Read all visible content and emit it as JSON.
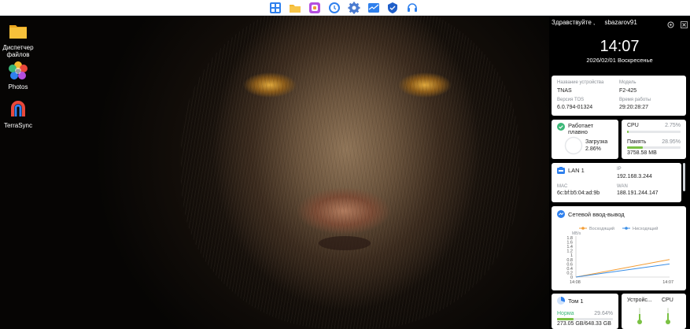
{
  "taskbar": {
    "apps": [
      {
        "name": "app-center-icon",
        "color": "#2f80ed"
      },
      {
        "name": "file-manager-icon",
        "color": "#f5b82e"
      },
      {
        "name": "photos-app-icon",
        "color": "#b44fe0"
      },
      {
        "name": "clock-app-icon",
        "color": "#2f80ed"
      },
      {
        "name": "settings-gear-icon",
        "color": "#4a7bd0"
      },
      {
        "name": "mail-icon",
        "color": "#2f80ed"
      },
      {
        "name": "security-shield-icon",
        "color": "#1f5fc9"
      },
      {
        "name": "support-headset-icon",
        "color": "#2f80ed"
      }
    ]
  },
  "desktop": {
    "items": [
      {
        "label": "Диспетчер\nфайлов",
        "icon": "folder-icon"
      },
      {
        "label": "Photos",
        "icon": "photos-icon"
      },
      {
        "label": "TerraSync",
        "icon": "terrasync-icon"
      }
    ]
  },
  "panel": {
    "greeting": "Здравствуйте ,",
    "username": "sbazarov91",
    "time": "14:07",
    "date": "2026/02/01 Воскресенье",
    "device": {
      "name_label": "Название устройства",
      "name_value": "TNAS",
      "model_label": "Модель",
      "model_value": "F2-425",
      "version_label": "Версия TOS",
      "version_value": "6.0.794-01324",
      "uptime_label": "Время работы",
      "uptime_value": "29:20:28:27"
    },
    "health": {
      "status": "Работает плавно",
      "load_label": "Загрузка",
      "load_value": "2.86%",
      "cpu_label": "CPU",
      "cpu_value": "2.75%",
      "cpu_fraction": 0.0275,
      "mem_label": "Память",
      "mem_value": "28.95%",
      "mem_fraction": 0.2895,
      "mem_used": "3758.58 MB"
    },
    "network": {
      "iface": "LAN 1",
      "ip_label": "IP",
      "ip_value": "192.168.3.244",
      "mac_label": "MAC",
      "mac_value": "6c:bf:b5:04:ad:9b",
      "wan_label": "WAN",
      "wan_value": "188.191.244.147"
    },
    "io": {
      "title": "Сетевой ввод-вывод"
    },
    "volume": {
      "name": "Том 1",
      "status": "Норма",
      "percent": "29.64%",
      "fraction": 0.2964,
      "usage": "273.05 GB/648.33 GB"
    },
    "temps": {
      "device_label": "Устройс...",
      "cpu_label": "CPU"
    }
  },
  "chart_data": {
    "type": "line",
    "title": "Сетевой ввод-вывод",
    "ylabel": "MB/s",
    "series": [
      {
        "name": "Восходящий",
        "color": "#f39c33",
        "values": [
          0,
          0.8
        ]
      },
      {
        "name": "Нисходящий",
        "color": "#3a8ee6",
        "values": [
          0,
          0.6
        ]
      }
    ],
    "x": [
      "14:08",
      "14:07"
    ],
    "yticks": [
      0,
      0.2,
      0.4,
      0.6,
      0.8,
      1,
      1.2,
      1.4,
      1.6,
      1.8
    ],
    "ylim": [
      0,
      1.8
    ],
    "legend": "top"
  }
}
